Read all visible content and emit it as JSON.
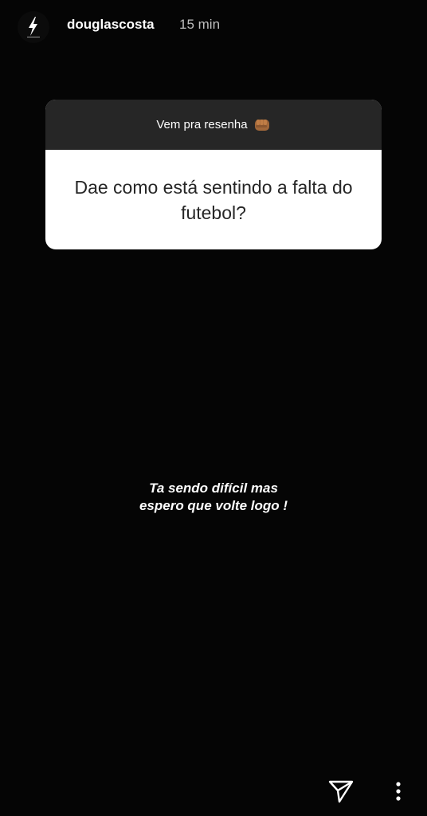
{
  "header": {
    "username": "douglascosta",
    "timestamp": "15 min",
    "avatar_icon": "lightning-bolt-logo"
  },
  "question_sticker": {
    "prompt": "Vem pra resenha",
    "prompt_icon": "raised-fist-emoji",
    "question": "Dae como está sentindo a falta do futebol?"
  },
  "caption": {
    "line1": "Ta sendo difícil mas",
    "line2": "espero que volte logo !"
  },
  "footer": {
    "send_icon": "paper-plane-icon",
    "more_icon": "more-vertical-icon"
  },
  "colors": {
    "background": "#050505",
    "sticker_header": "#262626",
    "sticker_body": "#ffffff",
    "text_primary": "#ffffff",
    "text_secondary": "#bdbdbd"
  }
}
